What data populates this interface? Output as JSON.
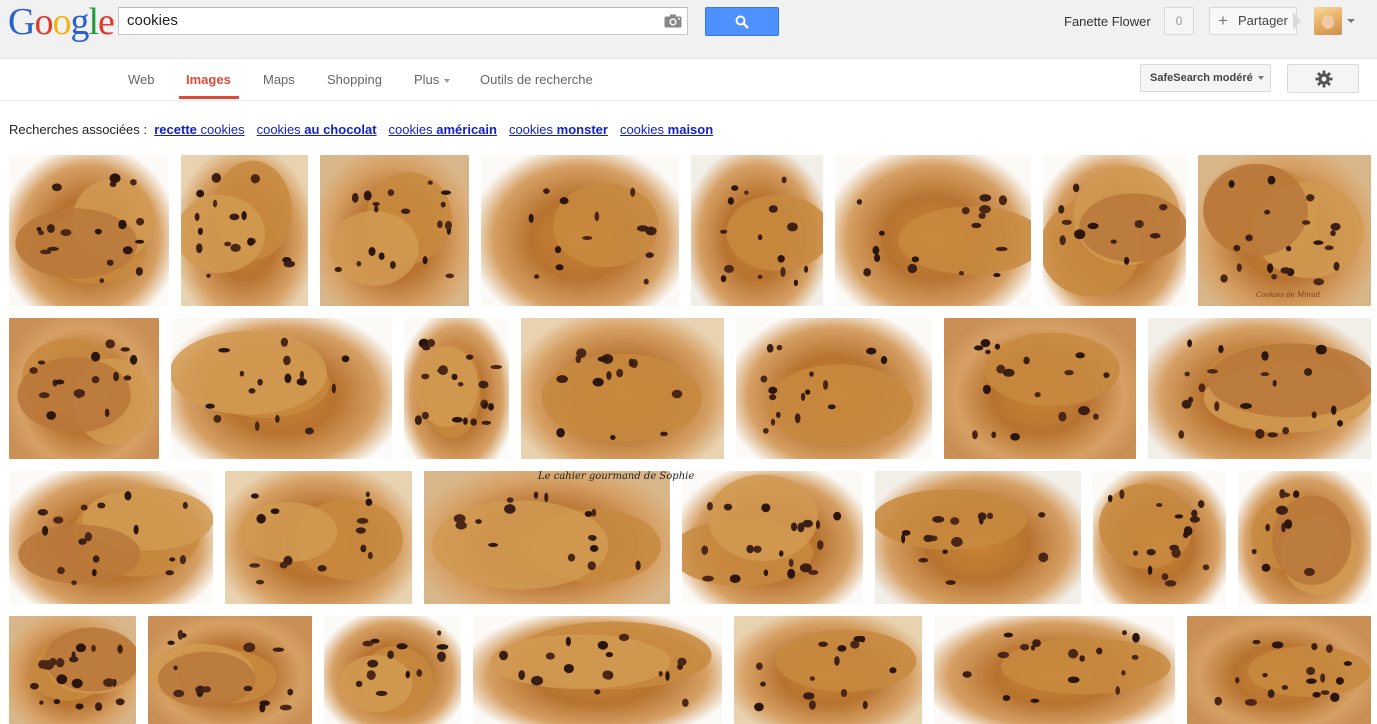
{
  "header": {
    "logo_letters": [
      "G",
      "o",
      "o",
      "g",
      "l",
      "e"
    ],
    "logo_colors": [
      "#2a62c9",
      "#de3b2e",
      "#f2b31a",
      "#2a62c9",
      "#1f9a3c",
      "#de3b2e"
    ],
    "search_value": "cookies",
    "user_name": "Fanette Flower",
    "notification_count": "0",
    "share_label": "Partager",
    "share_plus": "+",
    "accent_blue": "#4d90fe"
  },
  "nav": {
    "tabs": [
      {
        "label": "Web",
        "active": false
      },
      {
        "label": "Images",
        "active": true
      },
      {
        "label": "Maps",
        "active": false
      },
      {
        "label": "Shopping",
        "active": false
      },
      {
        "label": "Plus",
        "active": false
      },
      {
        "label": "Outils de recherche",
        "active": false
      }
    ],
    "safesearch_label": "SafeSearch modéré",
    "active_color": "#dd4b39"
  },
  "related": {
    "label": "Recherches associées :",
    "links": [
      {
        "plain": "",
        "bold": "recette",
        "plain_after": " cookies"
      },
      {
        "plain": "cookies ",
        "bold": "au chocolat",
        "plain_after": ""
      },
      {
        "plain": "cookies ",
        "bold": "américain",
        "plain_after": ""
      },
      {
        "plain": "cookies ",
        "bold": "monster",
        "plain_after": ""
      },
      {
        "plain": "cookies ",
        "bold": "maison",
        "plain_after": ""
      }
    ]
  },
  "results": {
    "count": 30,
    "image_captions": [
      "Cookies de Minuit",
      "Le cahier gourmand de Sophie"
    ]
  }
}
